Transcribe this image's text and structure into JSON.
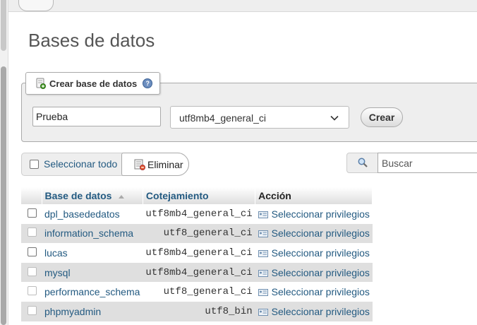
{
  "page": {
    "title": "Bases de datos"
  },
  "create": {
    "legend": "Crear base de datos",
    "db_name_value": "Prueba",
    "collation_value": "utf8mb4_general_ci",
    "create_label": "Crear"
  },
  "toolbar": {
    "select_all_label": "Seleccionar todo",
    "delete_label": "Eliminar",
    "search_placeholder": "Buscar"
  },
  "table": {
    "headers": {
      "name": "Base de datos",
      "collation": "Cotejamiento",
      "action": "Acción"
    },
    "rows": [
      {
        "name": "dpl_basededatos",
        "collation": "utf8mb4_general_ci",
        "action": "Seleccionar privilegios"
      },
      {
        "name": "information_schema",
        "collation": "utf8_general_ci",
        "action": "Seleccionar privilegios"
      },
      {
        "name": "lucas",
        "collation": "utf8mb4_general_ci",
        "action": "Seleccionar privilegios"
      },
      {
        "name": "mysql",
        "collation": "utf8mb4_general_ci",
        "action": "Seleccionar privilegios"
      },
      {
        "name": "performance_schema",
        "collation": "utf8_general_ci",
        "action": "Seleccionar privilegios"
      },
      {
        "name": "phpmyadmin",
        "collation": "utf8_bin",
        "action": "Seleccionar privilegios"
      }
    ]
  },
  "icons": {
    "menu": "hamburger-icon",
    "database": "database-add-icon",
    "help": "help-icon",
    "dropdown": "chevron-down-icon",
    "delete": "delete-icon",
    "search": "search-icon",
    "privileges": "privileges-icon"
  },
  "colors": {
    "link": "#235a81",
    "row_alt": "#dfdfdf",
    "panel": "#eeeeee"
  }
}
